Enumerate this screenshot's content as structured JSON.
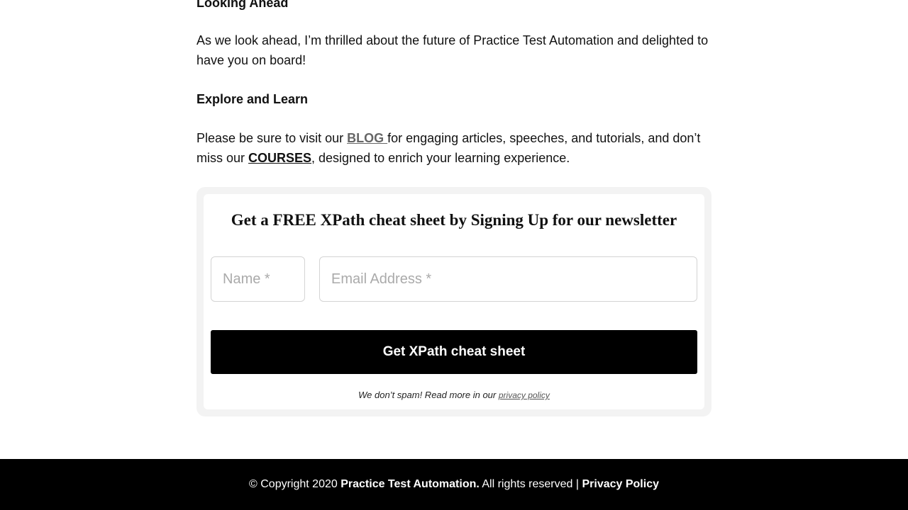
{
  "article": {
    "looking_ahead_heading": "Looking Ahead",
    "looking_ahead_text": "As we look ahead, I’m thrilled about the future of Practice Test Automation and delighted to have you on board!",
    "explore_heading": "Explore and Learn",
    "explore_text_before": "Please be sure to visit our ",
    "blog_link": "BLOG ",
    "explore_text_middle": "for engaging articles, speeches, and tutorials, and don’t miss our ",
    "courses_link": "COURSES",
    "explore_text_after": ", designed to enrich your learning experience."
  },
  "newsletter": {
    "title": "Get a FREE XPath cheat sheet by Signing Up for our newsletter",
    "name_placeholder": "Name *",
    "email_placeholder": "Email Address *",
    "submit_label": "Get XPath cheat sheet",
    "disclaimer_text": "We don’t spam! Read more in our ",
    "privacy_link": "privacy policy"
  },
  "footer": {
    "copyright_prefix": "© Copyright 2020 ",
    "brand": "Practice Test Automation.",
    "rights_text": " All rights reserved | ",
    "privacy_link": "Privacy Policy"
  },
  "colors": {
    "footer_bg": "#000000",
    "button_bg": "#000000",
    "card_border": "#f3f3f3",
    "blog_link": "#666666"
  }
}
